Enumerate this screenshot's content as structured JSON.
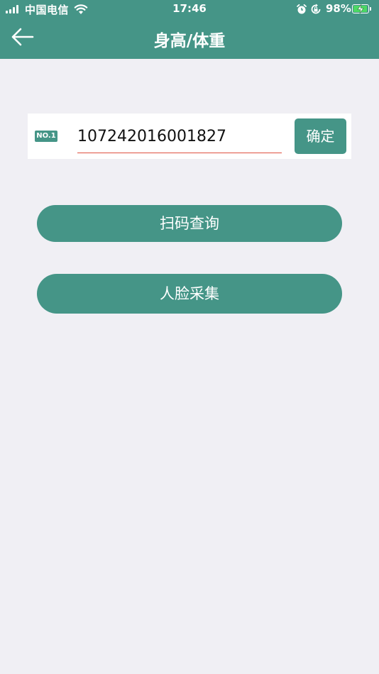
{
  "status_bar": {
    "carrier": "中国电信",
    "time": "17:46",
    "battery_percent": "98%",
    "battery_level": 0.98,
    "icons": [
      "signal-icon",
      "wifi-icon",
      "alarm-icon",
      "rotation-lock-icon",
      "battery-icon",
      "charging-bolt-icon"
    ]
  },
  "nav": {
    "title": "身高/体重",
    "back_icon": "back-arrow-icon"
  },
  "form": {
    "badge": "NO.1",
    "number_value": "10724201600​1827",
    "confirm_label": "确定"
  },
  "actions": {
    "scan_label": "扫码查询",
    "face_label": "人脸采集"
  },
  "colors": {
    "primary": "#459587",
    "background": "#f0eff4",
    "underline": "#e05040"
  }
}
